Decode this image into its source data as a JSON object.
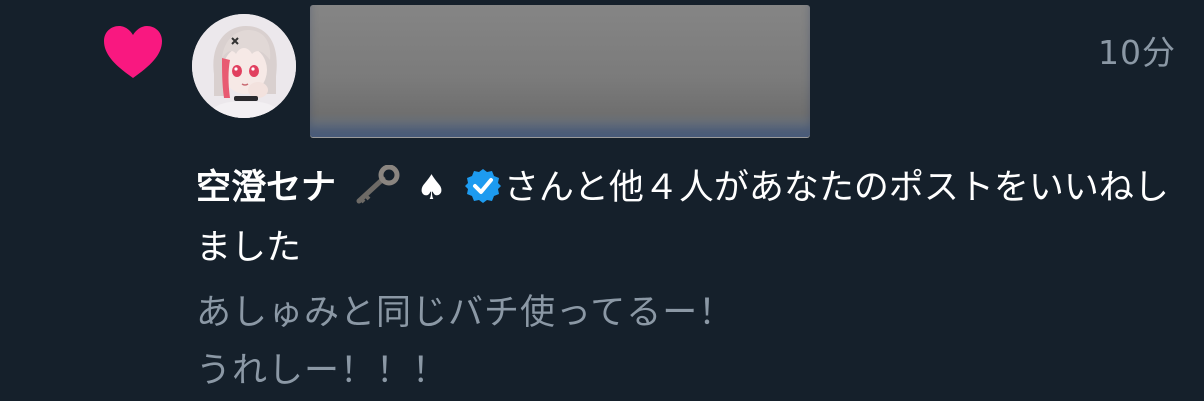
{
  "notification": {
    "timestamp": "10分",
    "sender_name": "空澄セナ",
    "sender_emojis": [
      "key-icon",
      "spade-icon"
    ],
    "spade_glyph": "♠",
    "verified": true,
    "action_text": "さんと他４人があなたのポストをいいねしました",
    "post_preview_lines": [
      "あしゅみと同じバチ使ってるー！",
      "うれしー！！！"
    ]
  },
  "colors": {
    "background": "#15202b",
    "heart": "#f91880",
    "verified": "#1d9bf0",
    "primary_text": "#ffffff",
    "secondary_text": "#8b98a5"
  }
}
